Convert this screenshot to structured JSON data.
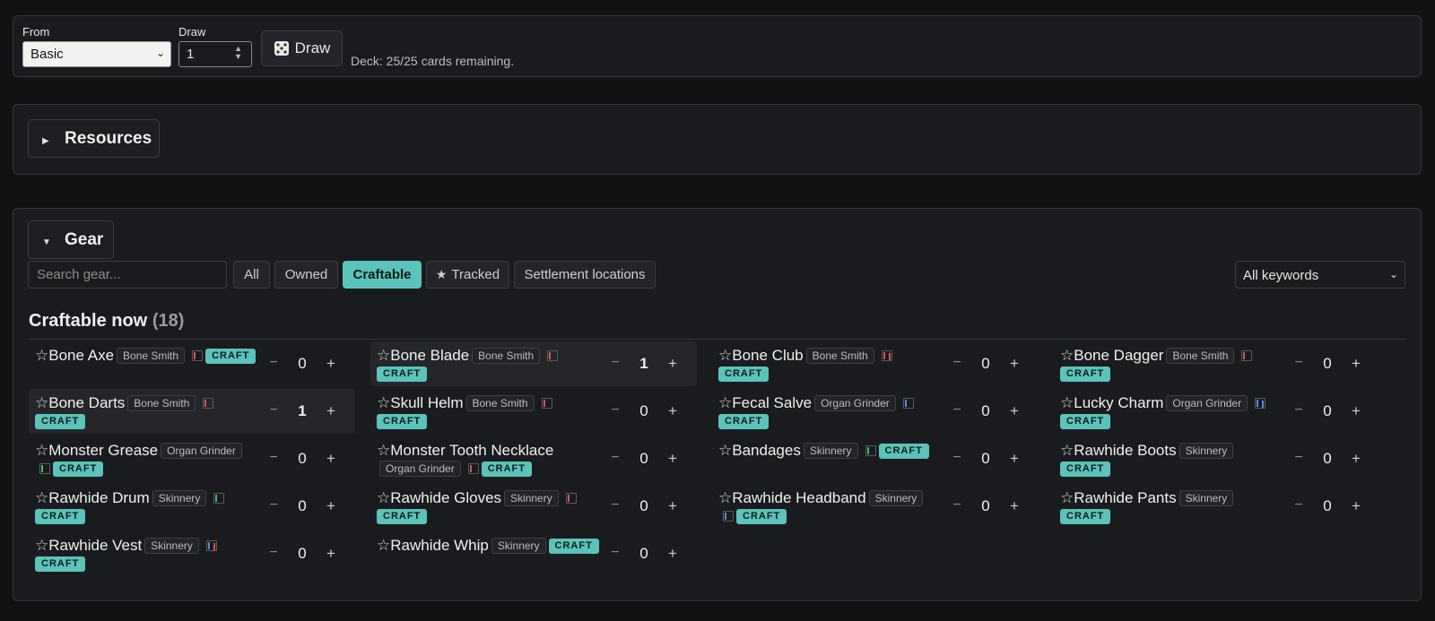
{
  "draw": {
    "from_label": "From",
    "from_value": "Basic",
    "draw_label": "Draw",
    "draw_value": "1",
    "draw_button_label": "Draw",
    "deck_status": "Deck: 25/25 cards remaining."
  },
  "resources": {
    "title": "Resources"
  },
  "gear": {
    "title": "Gear",
    "search_placeholder": "Search gear...",
    "filters": {
      "all": "All",
      "owned": "Owned",
      "craftable": "Craftable",
      "tracked": "Tracked",
      "settlement": "Settlement locations"
    },
    "active_filter": "Craftable",
    "keywords_value": "All keywords",
    "section_title": "Craftable now",
    "section_count": "(18)",
    "craft_label": "CRAFT",
    "items": [
      {
        "name": "Bone Axe",
        "location": "Bone Smith",
        "qty": "0",
        "affinities": [
          "red"
        ]
      },
      {
        "name": "Bone Blade",
        "location": "Bone Smith",
        "qty": "1",
        "affinities": [
          "red"
        ]
      },
      {
        "name": "Bone Club",
        "location": "Bone Smith",
        "qty": "0",
        "affinities": [
          "red",
          "red"
        ]
      },
      {
        "name": "Bone Dagger",
        "location": "Bone Smith",
        "qty": "0",
        "affinities": [
          "red"
        ]
      },
      {
        "name": "Bone Darts",
        "location": "Bone Smith",
        "qty": "1",
        "affinities": [
          "red"
        ]
      },
      {
        "name": "Skull Helm",
        "location": "Bone Smith",
        "qty": "0",
        "affinities": [
          "red"
        ]
      },
      {
        "name": "Fecal Salve",
        "location": "Organ Grinder",
        "qty": "0",
        "affinities": [
          "blue"
        ]
      },
      {
        "name": "Lucky Charm",
        "location": "Organ Grinder",
        "qty": "0",
        "affinities": [
          "blue",
          "blue"
        ]
      },
      {
        "name": "Monster Grease",
        "location": "Organ Grinder",
        "qty": "0",
        "affinities": [
          "green"
        ]
      },
      {
        "name": "Monster Tooth Necklace",
        "location": "Organ Grinder",
        "qty": "0",
        "affinities": [
          "red"
        ]
      },
      {
        "name": "Bandages",
        "location": "Skinnery",
        "qty": "0",
        "affinities": [
          "green"
        ]
      },
      {
        "name": "Rawhide Boots",
        "location": "Skinnery",
        "qty": "0",
        "affinities": []
      },
      {
        "name": "Rawhide Drum",
        "location": "Skinnery",
        "qty": "0",
        "affinities": [
          "green"
        ]
      },
      {
        "name": "Rawhide Gloves",
        "location": "Skinnery",
        "qty": "0",
        "affinities": [
          "red"
        ]
      },
      {
        "name": "Rawhide Headband",
        "location": "Skinnery",
        "qty": "0",
        "affinities": [
          "blue"
        ]
      },
      {
        "name": "Rawhide Pants",
        "location": "Skinnery",
        "qty": "0",
        "affinities": []
      },
      {
        "name": "Rawhide Vest",
        "location": "Skinnery",
        "qty": "0",
        "affinities": [
          "blue",
          "red"
        ]
      },
      {
        "name": "Rawhide Whip",
        "location": "Skinnery",
        "qty": "0",
        "affinities": []
      }
    ]
  },
  "colors": {
    "accent": "#5bc3bb",
    "affinity_red": "#e0514b",
    "affinity_blue": "#4f8ee8",
    "affinity_green": "#3fbf5a"
  },
  "icons": {
    "draw_button": "die-icon",
    "tracked_filter": "star-icon",
    "gear_row": "star-outline-icon"
  }
}
